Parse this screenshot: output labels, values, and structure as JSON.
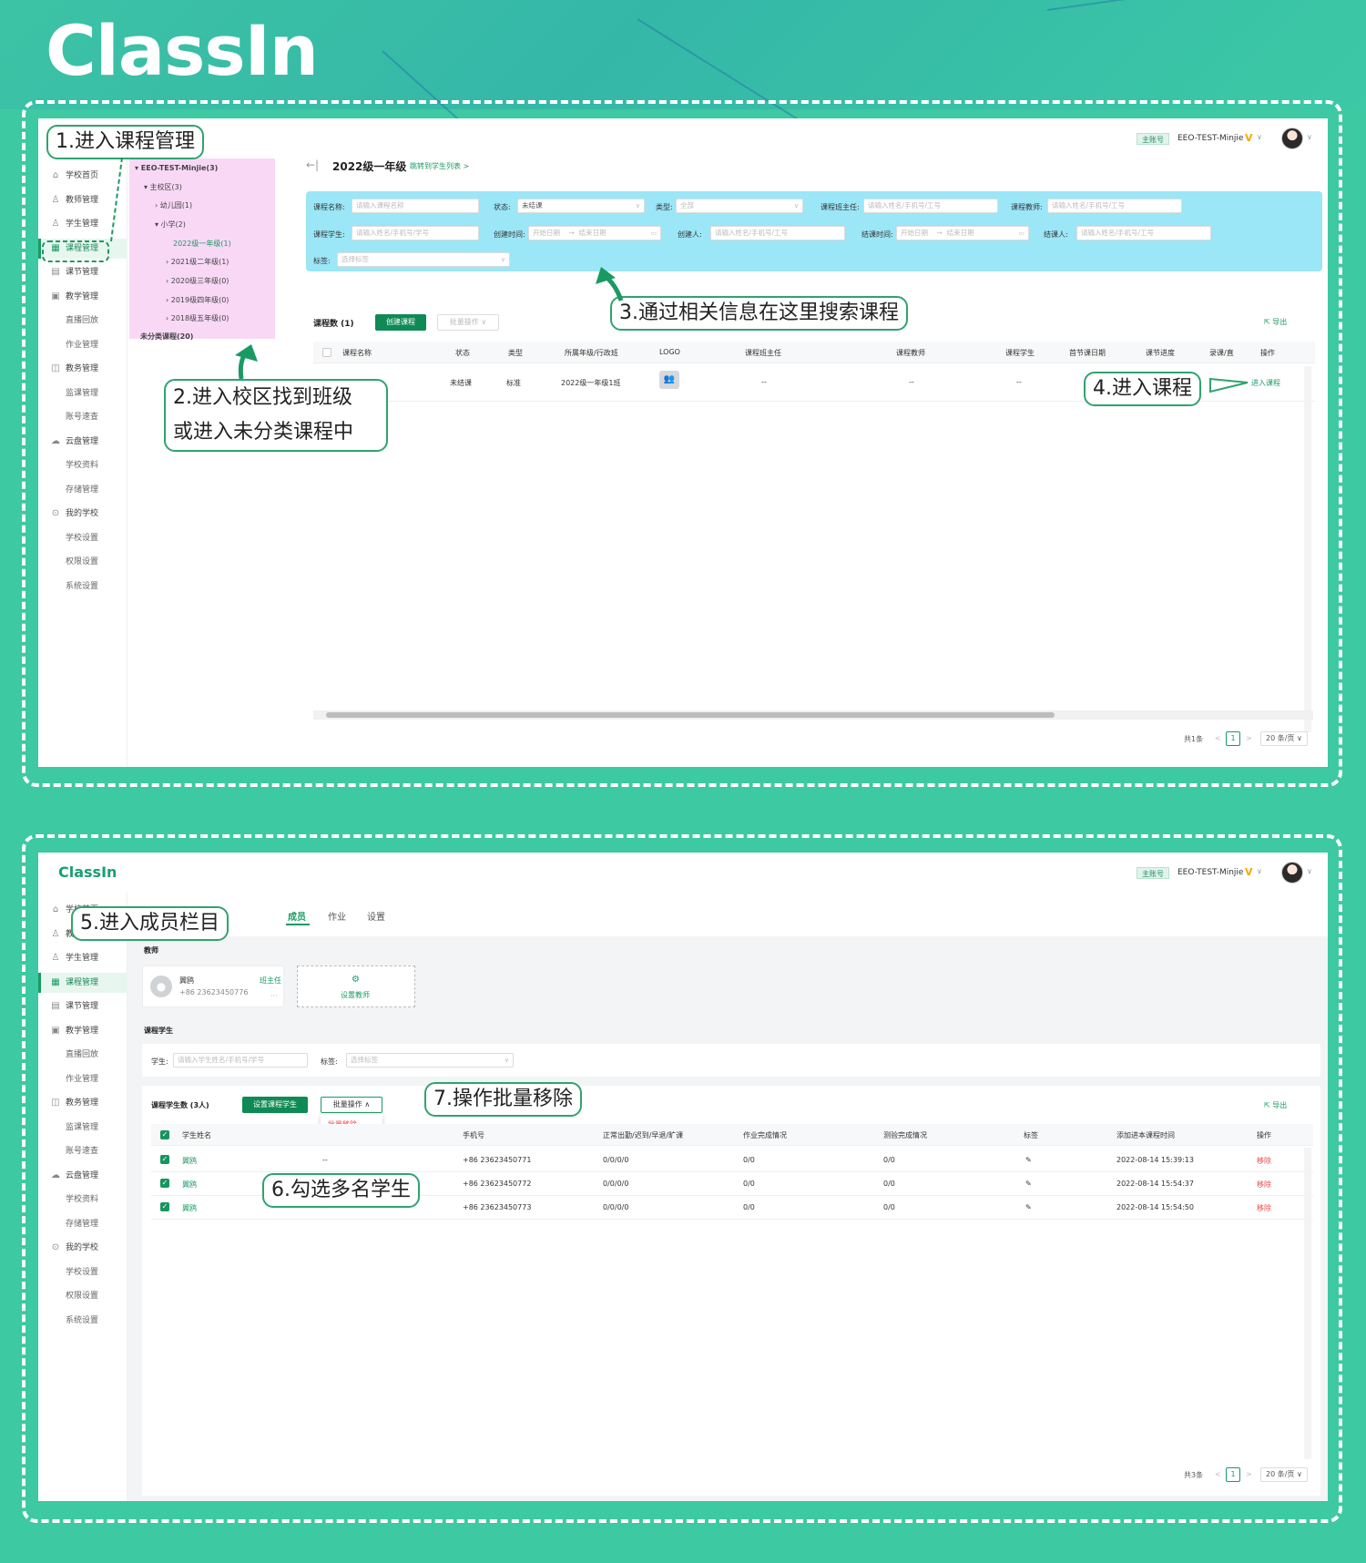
{
  "brand": {
    "logo": "ClassIn",
    "logo_small": "ClassIn"
  },
  "account": {
    "badge": "主账号",
    "name": "EEO-TEST-Minjie",
    "vip": "V",
    "caret": "∨"
  },
  "sidebar": {
    "items": [
      {
        "label": "学校首页",
        "icon": "⌂",
        "icon_name": "home-icon"
      },
      {
        "label": "教师管理",
        "icon": "♙",
        "icon_name": "teacher-icon"
      },
      {
        "label": "学生管理",
        "icon": "♙",
        "icon_name": "student-icon"
      },
      {
        "label": "课程管理",
        "icon": "▦",
        "icon_name": "course-icon"
      },
      {
        "label": "课节管理",
        "icon": "▤",
        "icon_name": "lesson-icon"
      },
      {
        "label": "教学管理",
        "icon": "▣",
        "icon_name": "teaching-icon"
      },
      {
        "label": "直播回放",
        "icon": "",
        "icon_name": ""
      },
      {
        "label": "作业管理",
        "icon": "",
        "icon_name": ""
      },
      {
        "label": "教务管理",
        "icon": "◫",
        "icon_name": "academic-icon"
      },
      {
        "label": "监课管理",
        "icon": "",
        "icon_name": ""
      },
      {
        "label": "账号速查",
        "icon": "",
        "icon_name": ""
      },
      {
        "label": "云盘管理",
        "icon": "☁",
        "icon_name": "cloud-icon"
      },
      {
        "label": "学校资料",
        "icon": "",
        "icon_name": ""
      },
      {
        "label": "存储管理",
        "icon": "",
        "icon_name": ""
      },
      {
        "label": "我的学校",
        "icon": "⊙",
        "icon_name": "school-icon"
      },
      {
        "label": "学校设置",
        "icon": "",
        "icon_name": ""
      },
      {
        "label": "权限设置",
        "icon": "",
        "icon_name": ""
      },
      {
        "label": "系统设置",
        "icon": "",
        "icon_name": ""
      }
    ]
  },
  "tree": {
    "root": "▾ EEO-TEST-Minjie(3)",
    "campus": "▾ 主校区(3)",
    "kinder": "› 幼儿园(1)",
    "primary": "▾ 小学(2)",
    "g2022": "2022级一年级(1)",
    "g2021": "› 2021级二年级(1)",
    "g2020": "› 2020级三年级(0)",
    "g2019": "› 2019级四年级(0)",
    "g2018": "› 2018级五年级(0)",
    "uncat": "未分类课程(20)"
  },
  "panel1": {
    "back": "←|",
    "title": "2022级一年级",
    "jump": "跳转到学生列表 >",
    "filters": {
      "course_name_label": "课程名称:",
      "course_name_ph": "请输入课程名称",
      "status_label": "状态:",
      "status_val": "未结课",
      "type_label": "类型:",
      "type_val": "全部",
      "head_label": "课程班主任:",
      "head_ph": "请输入姓名/手机号/工号",
      "teacher_label": "课程教师:",
      "teacher_ph": "请输入姓名/手机号/工号",
      "student_label": "课程学生:",
      "student_ph": "请输入姓名/手机号/学号",
      "created_label": "创建时间:",
      "date_start": "开始日期",
      "date_arrow": "→",
      "date_end": "结束日期",
      "creator_label": "创建人:",
      "creator_ph": "请输入姓名/手机号/工号",
      "ended_label": "结课时间:",
      "closer_label": "结课人:",
      "closer_ph": "请输入姓名/手机号/工号",
      "tag_label": "标签:",
      "tag_ph": "选择标签",
      "caret": "∨",
      "cal": "▭"
    },
    "count_label": "课程数 (1)",
    "create_btn": "创建课程",
    "batch_btn": "批量操作 ∨",
    "export": "⇱ 导出",
    "columns": [
      "课程名称",
      "状态",
      "类型",
      "所属年级/行政班",
      "LOGO",
      "课程班主任",
      "课程教师",
      "课程学生",
      "首节课日期",
      "课节进度",
      "录课/直",
      "操作"
    ],
    "row": {
      "status": "未结课",
      "type": "标准",
      "class": "2022级一年级1班",
      "logo": "👥",
      "head": "--",
      "teacher": "--",
      "student": "--",
      "action": "进入课程"
    },
    "pager": {
      "total": "共1条",
      "prev": "<",
      "page": "1",
      "next": ">",
      "size": "20 条/页 ∨"
    }
  },
  "callouts": {
    "c1": "1.进入课程管理",
    "c2a": "2.进入校区找到班级",
    "c2b": "或进入未分类课程中",
    "c3": "3.通过相关信息在这里搜索课程",
    "c4": "4.进入课程",
    "c5": "5.进入成员栏目",
    "c6": "6.勾选多名学生",
    "c7": "7.操作批量移除"
  },
  "panel2": {
    "tabs": [
      "成员",
      "作业",
      "设置"
    ],
    "teacher_section": "教师",
    "teacher": {
      "name": "翼鸥",
      "role": "班主任",
      "phone": "+86 23623450776",
      "more": "···"
    },
    "set_teacher": {
      "icon": "⚙",
      "label": "设置教师"
    },
    "student_section": "课程学生",
    "student_label": "学生:",
    "student_ph": "请输入学生姓名/手机号/学号",
    "tag_label": "标签:",
    "tag_ph": "选择标签",
    "count_label": "课程学生数 (3人)",
    "set_students_btn": "设置课程学生",
    "batch_btn": "批量操作 ∧",
    "batch_remove": "批量移除",
    "export": "⇱ 导出",
    "columns": [
      "学生姓名",
      "手机号",
      "正常出勤/迟到/早退/旷课",
      "作业完成情况",
      "测验完成情况",
      "标签",
      "添加进本课程时间",
      "操作"
    ],
    "rows": [
      {
        "name": "翼鸥",
        "dash": "--",
        "phone": "+86 23623450771",
        "att": "0/0/0/0",
        "hw": "0/0",
        "quiz": "0/0",
        "tag": "✎",
        "time": "2022-08-14 15:39:13",
        "op": "移除"
      },
      {
        "name": "翼鸥",
        "dash": "--",
        "phone": "+86 23623450772",
        "att": "0/0/0/0",
        "hw": "0/0",
        "quiz": "0/0",
        "tag": "✎",
        "time": "2022-08-14 15:54:37",
        "op": "移除"
      },
      {
        "name": "翼鸥",
        "dash": "--",
        "phone": "+86 23623450773",
        "att": "0/0/0/0",
        "hw": "0/0",
        "quiz": "0/0",
        "tag": "✎",
        "time": "2022-08-14 15:54:50",
        "op": "移除"
      }
    ],
    "check": "✓",
    "pager": {
      "total": "共3条",
      "prev": "<",
      "page": "1",
      "next": ">",
      "size": "20 条/页 ∨"
    }
  },
  "colors": {
    "accent": "#1a9a63",
    "background": "#3dc9a1",
    "tree_highlight": "#f9d8f6",
    "search_highlight": "#9be6f7",
    "danger": "#e84b4b"
  }
}
